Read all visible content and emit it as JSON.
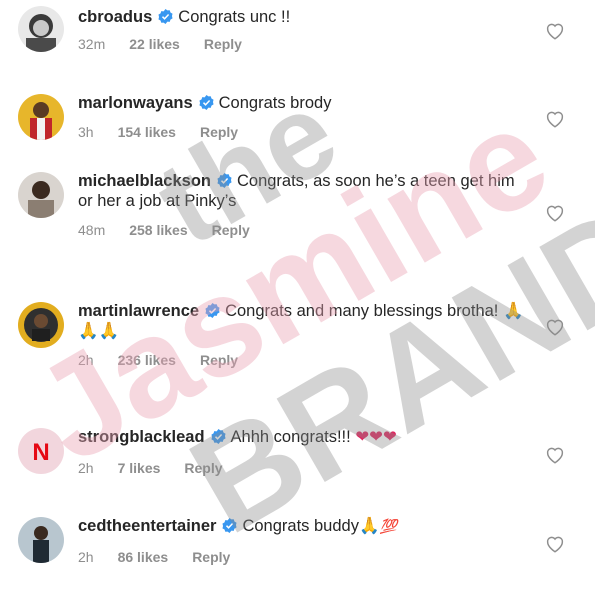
{
  "comments": [
    {
      "username": "cbroadus",
      "text": "Congrats unc !!",
      "time": "32m",
      "likes": "22 likes",
      "reply": "Reply",
      "avatar_color": "#6b6b6b"
    },
    {
      "username": "marlonwayans",
      "text": "Congrats brody",
      "time": "3h",
      "likes": "154 likes",
      "reply": "Reply",
      "avatar_color": "#d8a21a"
    },
    {
      "username": "michaelblackson",
      "text": "Congrats, as soon he’s a teen get him or her a job at Pinky’s",
      "time": "48m",
      "likes": "258 likes",
      "reply": "Reply",
      "avatar_color": "#7a6a5e"
    },
    {
      "username": "martinlawrence",
      "text": "Congrats and many blessings brotha!",
      "emoji": "🙏🙏🙏",
      "time": "2h",
      "likes": "236 likes",
      "reply": "Reply",
      "avatar_color": "#d9a520"
    },
    {
      "username": "strongblacklead",
      "text": "Ahhh congrats!!!",
      "emoji": "❤❤❤",
      "time": "2h",
      "likes": "7 likes",
      "reply": "Reply",
      "avatar_color": "#f2d6dd",
      "avatar_letter": "N"
    },
    {
      "username": "cedtheentertainer",
      "text": "Congrats buddy",
      "emoji": "🙏",
      "emoji2": "💯",
      "time": "2h",
      "likes": "86 likes",
      "reply": "Reply",
      "avatar_color": "#5d6b75"
    }
  ],
  "watermark": {
    "line1": "the",
    "line2": "Jasmine",
    "line3": "BRAND"
  },
  "colors": {
    "text": "#262626",
    "meta": "#8e8e8e",
    "verified": "#3897f0",
    "watermark_pink": "#e9a3b3",
    "watermark_gray": "#8c8c8c"
  }
}
